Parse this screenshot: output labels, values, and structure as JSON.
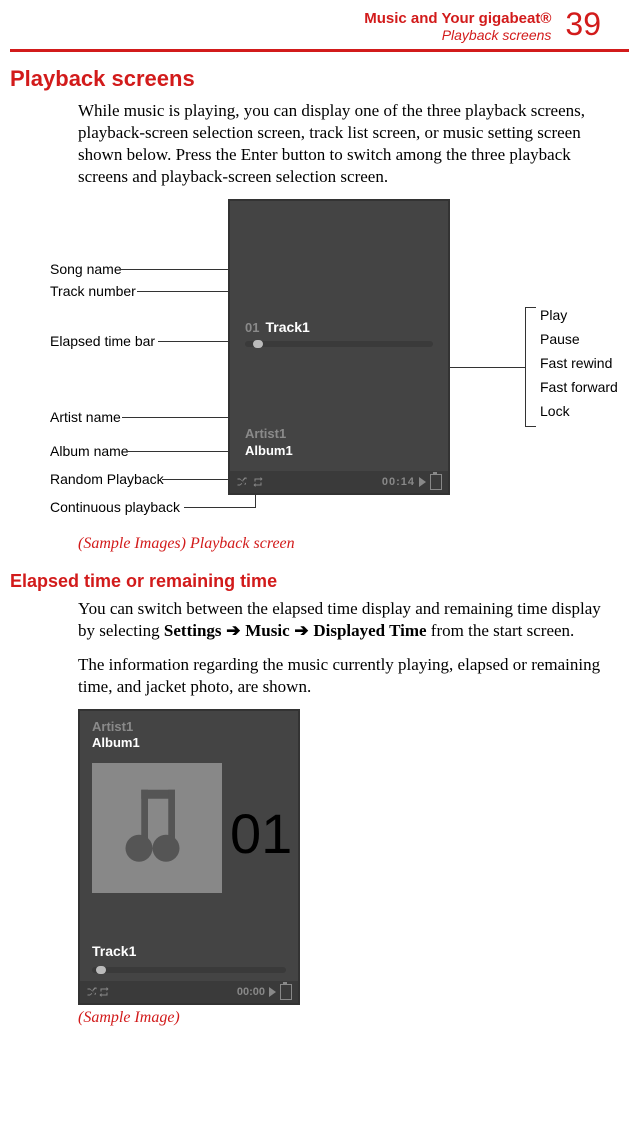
{
  "header": {
    "chapter": "Music and Your gigabeat®",
    "section": "Playback screens",
    "page_number": "39"
  },
  "h1": "Playback screens",
  "para1": "While music is playing, you can display one of the three playback screens, playback-screen selection screen, track list screen, or music setting screen shown below. Press the Enter button to switch among the three playback screens and playback-screen selection screen.",
  "figure1": {
    "left_labels": {
      "song_name": "Song name",
      "track_number": "Track number",
      "elapsed_time_bar": "Elapsed time bar",
      "artist_name": "Artist name",
      "album_name": "Album name",
      "random_playback": "Random Playback",
      "continuous_playback": "Continuous playback"
    },
    "right_labels": {
      "play": "Play",
      "pause": "Pause",
      "fast_rewind": "Fast rewind",
      "fast_forward": "Fast forward",
      "lock": "Lock"
    },
    "screen": {
      "track_number": "01",
      "track_name": "Track1",
      "artist": "Artist1",
      "album": "Album1",
      "time": "00:14"
    },
    "caption": "(Sample Images) Playback screen"
  },
  "h2": "Elapsed time or remaining time",
  "para2_pre": "You can switch between the elapsed time display and remaining time display by selecting ",
  "para2_path1": "Settings",
  "para2_arrow": " ➔ ",
  "para2_path2": "Music",
  "para2_path3": "Displayed Time",
  "para2_post": " from the start screen.",
  "para3": "The information regarding the music currently playing, elapsed or remaining time, and jacket photo, are shown.",
  "figure2": {
    "artist": "Artist1",
    "album": "Album1",
    "big_number": "01",
    "track_name": "Track1",
    "time": "00:00",
    "caption": "(Sample Image)"
  }
}
